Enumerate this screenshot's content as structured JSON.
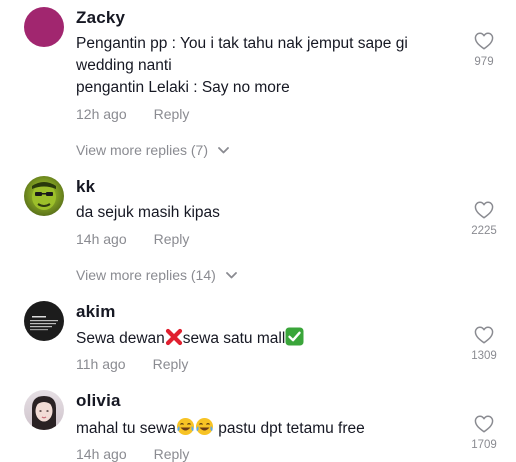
{
  "comments": [
    {
      "username": "Zacky",
      "lines": [
        "Pengantin pp : You i tak tahu nak jemput sape gi",
        "wedding nanti",
        "pengantin Lelaki : Say no more"
      ],
      "time": "12h ago",
      "reply_label": "Reply",
      "like_count": "979",
      "view_more_label": "View more replies (7)",
      "avatar_color": "#a1266f"
    },
    {
      "username": "kk",
      "lines": [
        "da sejuk masih kipas"
      ],
      "time": "14h ago",
      "reply_label": "Reply",
      "like_count": "2225",
      "view_more_label": "View more replies (14)",
      "avatar_color": "#6b8a1c"
    },
    {
      "username": "akim",
      "line_parts": [
        "Sewa dewan",
        "sewa satu mall"
      ],
      "time": "11h ago",
      "reply_label": "Reply",
      "like_count": "1309",
      "avatar_color": "#1c1c1c"
    },
    {
      "username": "olivia",
      "line_parts": [
        "mahal tu sewa",
        " pastu dpt tetamu free"
      ],
      "time": "14h ago",
      "reply_label": "Reply",
      "like_count": "1709",
      "avatar_color": "#d8d0d8"
    }
  ],
  "icons": {
    "like": "heart-outline-icon",
    "expand": "chevron-down-icon",
    "cross": "red-cross-mark-emoji",
    "check": "green-check-mark-emoji",
    "laugh": "tears-of-joy-emoji"
  },
  "colors": {
    "text": "#161823",
    "muted": "#8a8b91",
    "cross": "#e0202f",
    "check": "#3aa53a"
  }
}
